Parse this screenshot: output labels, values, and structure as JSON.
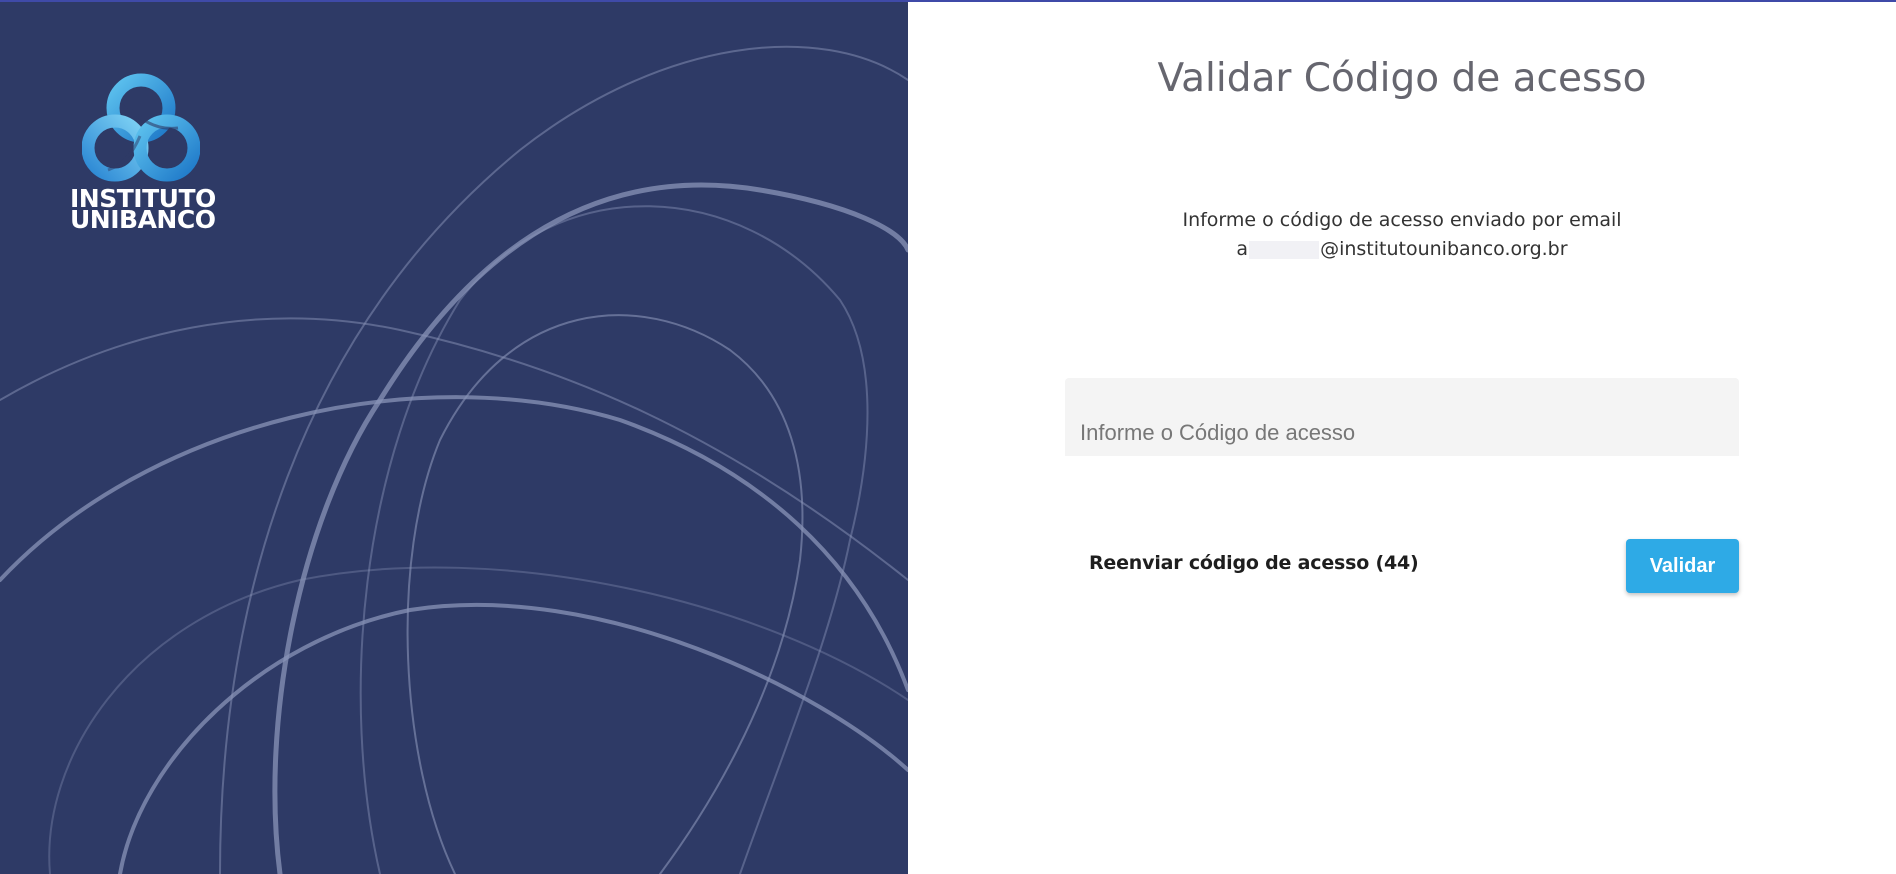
{
  "brand": {
    "logo_line1": "INSTITUTO",
    "logo_line2": "UNIBANCO",
    "logo_icon": "trefoil-knot-logo",
    "panel_color": "#2e3a66",
    "accent_color": "#2eaae6"
  },
  "main": {
    "title": "Validar Código de acesso",
    "info_line1": "Informe o código de acesso enviado por email",
    "email_prefix": "a",
    "email_domain": "@institutounibanco.org.br"
  },
  "form": {
    "code_placeholder": "Informe o Código de acesso",
    "code_value": "",
    "resend_label": "Reenviar código de acesso (44)",
    "validate_label": "Validar"
  }
}
